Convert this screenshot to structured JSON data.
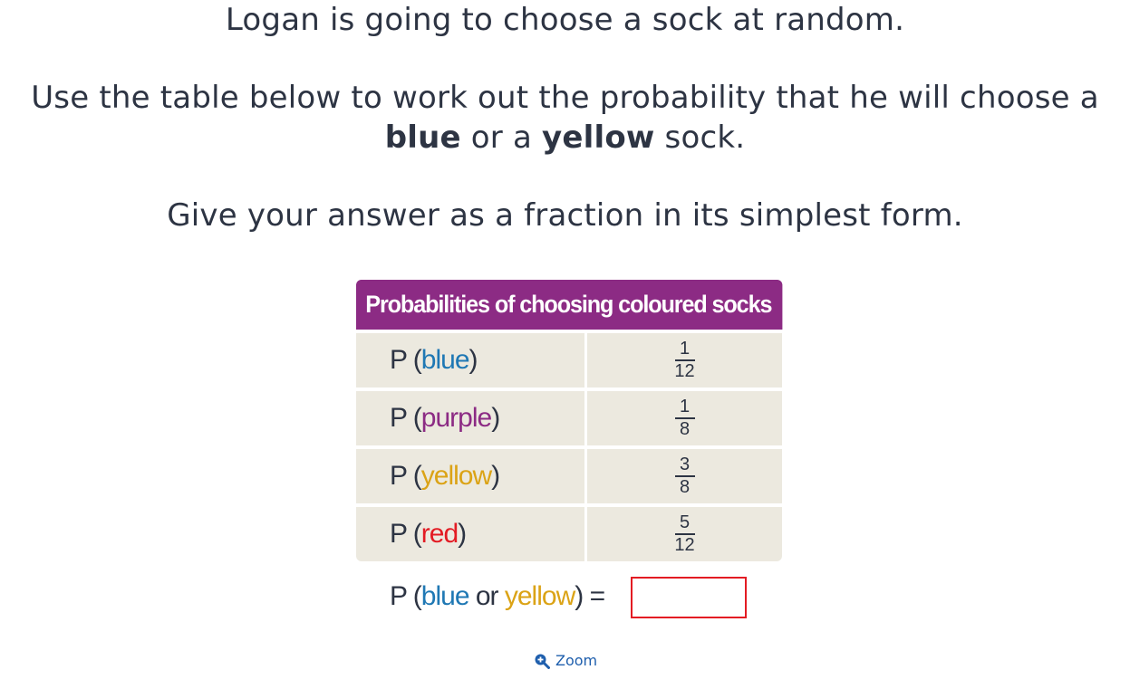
{
  "question": {
    "line1": "Logan is going to choose a sock at random.",
    "line2": "Use the table below to work out the probability that he will choose a",
    "line3_part1": "blue",
    "line3_part2": " or a ",
    "line3_part3": "yellow",
    "line3_part4": " sock.",
    "line4": "Give your answer as a fraction in its simplest form."
  },
  "table": {
    "header": "Probabilities of choosing coloured socks",
    "rows": [
      {
        "prefix": "P (",
        "colour": "blue",
        "suffix": ")",
        "num": "1",
        "den": "12",
        "hex": "#1f78b4"
      },
      {
        "prefix": "P (",
        "colour": "purple",
        "suffix": ")",
        "num": "1",
        "den": "8",
        "hex": "#8c2b84"
      },
      {
        "prefix": "P (",
        "colour": "yellow",
        "suffix": ")",
        "num": "3",
        "den": "8",
        "hex": "#dba316"
      },
      {
        "prefix": "P (",
        "colour": "red",
        "suffix": ")",
        "num": "5",
        "den": "12",
        "hex": "#e31b23"
      }
    ]
  },
  "answer": {
    "prefix": "P (",
    "blue": "blue",
    "or": " or ",
    "yellow": "yellow",
    "suffix": ") =",
    "value": ""
  },
  "zoom": {
    "label": "Zoom",
    "icon": "zoom-in-icon"
  },
  "colors": {
    "text": "#2d3443",
    "header_bg": "#8c2b84",
    "cell_bg": "#ece9df",
    "answer_border": "#e31b23",
    "link": "#1f5fad"
  }
}
